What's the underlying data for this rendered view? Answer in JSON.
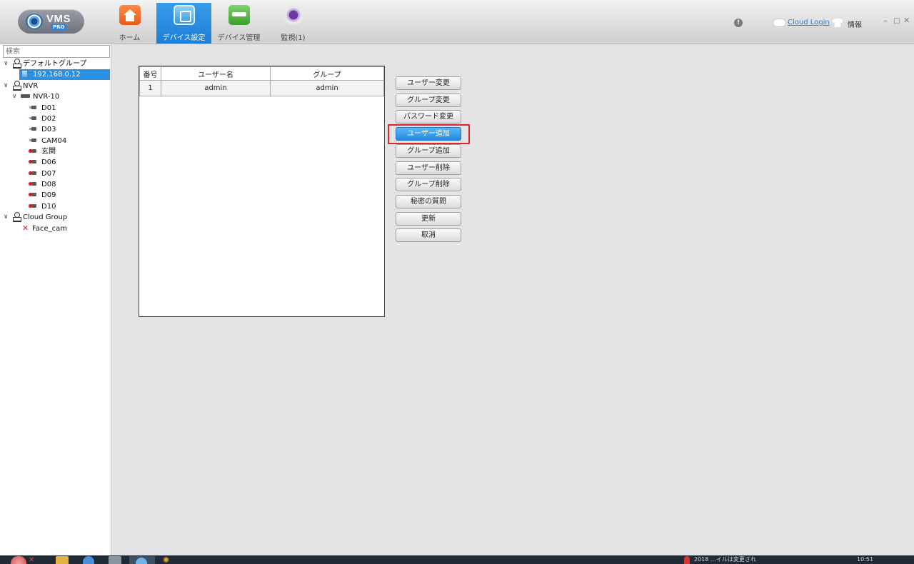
{
  "app": {
    "logo_text": "VMS",
    "logo_sub": "PRO"
  },
  "nav": {
    "tabs": [
      {
        "label": "ホーム",
        "icon": "home-icon"
      },
      {
        "label": "デバイス設定",
        "icon": "device-settings-icon",
        "active": true
      },
      {
        "label": "デバイス管理",
        "icon": "device-manager-icon"
      },
      {
        "label": "監視(1)",
        "icon": "monitor-icon"
      }
    ]
  },
  "topright": {
    "alert": "!",
    "cloud_login": "Cloud Login",
    "info": "情報",
    "minimize": "–",
    "maximize": "□",
    "close": "✕"
  },
  "sidebar": {
    "search_placeholder": "検索",
    "tree": {
      "default_group": "デフォルトグループ",
      "device_ip": "192.168.0.12",
      "nvr_group": "NVR",
      "nvr_device": "NVR-10",
      "channels": [
        "D01",
        "D02",
        "D03",
        "CAM04",
        "玄関",
        "D06",
        "D07",
        "D08",
        "D09",
        "D10"
      ],
      "cloud_group": "Cloud Group",
      "cloud_device": "Face_cam"
    }
  },
  "table": {
    "headers": [
      "番号",
      "ユーザー名",
      "グループ"
    ],
    "rows": [
      [
        "1",
        "admin",
        "admin"
      ]
    ]
  },
  "buttons": {
    "change_user": "ユーザー変更",
    "change_group": "グループ変更",
    "change_password": "パスワード変更",
    "add_user": "ユーザー追加",
    "add_group": "グループ追加",
    "delete_user": "ユーザー削除",
    "delete_group": "グループ削除",
    "secret_question": "秘密の質問",
    "update": "更新",
    "cancel": "取消"
  },
  "taskbar": {
    "clock": "10:51",
    "tray_text": "2018 …イルは変更され"
  },
  "colors": {
    "accent": "#1e8ae2",
    "highlight": "#e0262a",
    "selection": "#2b8fe2"
  }
}
